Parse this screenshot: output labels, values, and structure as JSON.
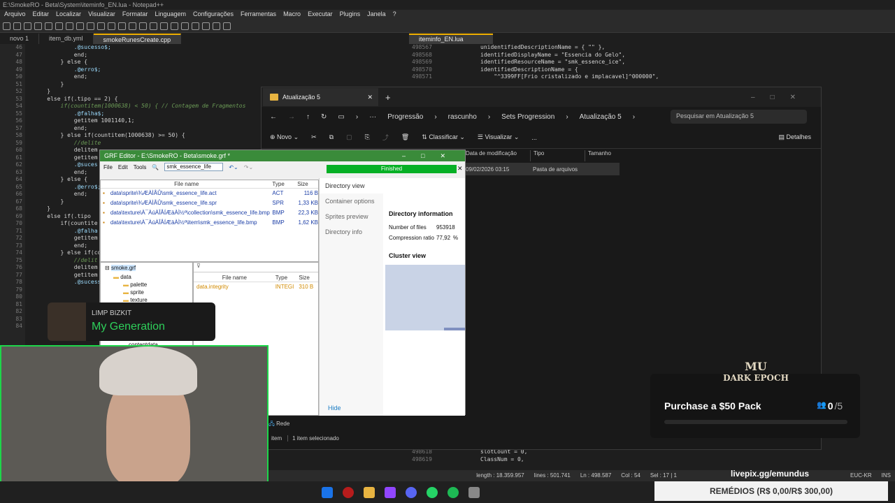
{
  "npp": {
    "title": "E:\\SmokeRO - Beta\\System\\iteminfo_EN.lua - Notepad++",
    "menu": [
      "Arquivo",
      "Editar",
      "Localizar",
      "Visualizar",
      "Formatar",
      "Linguagem",
      "Configurações",
      "Ferramentas",
      "Macro",
      "Executar",
      "Plugins",
      "Janela",
      "?"
    ],
    "tabs_left": [
      "novo 1",
      "item_db.yml",
      "smokeRunesCreate.cpp"
    ],
    "tab_right": "iteminfo_EN.lua",
    "left_lines": [
      "46",
      "47",
      "48",
      "49",
      "50",
      "51",
      "52",
      "53",
      "54",
      "55",
      "56",
      "57",
      "58",
      "59",
      "60",
      "61",
      "62",
      "63",
      "64",
      "65",
      "66",
      "67",
      "68",
      "69",
      "70",
      "71",
      "72",
      "73",
      "74",
      "75",
      "76",
      "77",
      "78",
      "79",
      "80",
      "81",
      "82",
      "83",
      "84"
    ],
    "left_code": [
      "            .@sucesso$;",
      "            end;",
      "        } else {",
      "            .@erro$;",
      "            end;",
      "        }",
      "    }",
      "    else if(.tipo == 2) {",
      "        if(countitem(1000638) < 50) { // Contagem de Fragmentos",
      "            .@falha$;",
      "            getitem 1001140,1;",
      "            end;",
      "        } else if(countitem(1000638) >= 50) {",
      "            //delite",
      "            delitem",
      "            getitem",
      "            .@suces",
      "            end;",
      "        } else {",
      "            .@erro$;",
      "            end;",
      "        }",
      "    }",
      "    else if(.tipo",
      "        if(countite",
      "            .@falha",
      "            getitem",
      "            end;",
      "        } else if(co",
      "            //delit",
      "            delitem",
      "            getitem",
      "            .@sucess",
      "",
      "",
      "",
      "",
      "",
      ""
    ],
    "right_lines": [
      "498567",
      "498568",
      "498569",
      "498570",
      "498571"
    ],
    "right_code": [
      "unidentifiedDescriptionName = { \"\" },",
      "identifiedDisplayName = \"Essencia do Gelo\",",
      "identifiedResourceName = \"smk_essence_ice\",",
      "identifiedDescriptionName = {",
      "    \"^3399FF[Frio cristalizado e implacavel]^000000\","
    ],
    "right_bottom_lines": [
      "498618",
      "498619"
    ],
    "right_bottom_code": [
      "slotCount = 0,",
      "ClassNum = 0,"
    ],
    "status": {
      "length": "length : 18.359.957",
      "lines": "lines : 501.741",
      "pos": "Ln : 498.587",
      "col": "Col : 54",
      "sel": "Sel : 17 | 1",
      "enc": "EUC-KR",
      "ins": "INS"
    }
  },
  "explorer": {
    "tab_title": "Atualização 5",
    "breadcrumb": [
      "Progressão",
      "rascunho",
      "Sets Progression",
      "Atualização 5"
    ],
    "search_placeholder": "Pesquisar em Atualização 5",
    "cmd": {
      "new": "Novo",
      "sort": "Classificar",
      "view": "Visualizar",
      "more": "...",
      "details": "Detalhes"
    },
    "columns": [
      "Data de modificação",
      "Tipo",
      "Tamanho"
    ],
    "row": {
      "date": "09/02/2026 03:15",
      "type": "Pasta de arquivos"
    },
    "sidebar_item": "Rede",
    "status_count": "item",
    "status_selected": "1 item selecionado"
  },
  "grf": {
    "title": "GRF Editor - E:\\SmokeRO - Beta\\smoke.grf *",
    "menu": [
      "File",
      "Edit",
      "Tools"
    ],
    "search_value": "smk_essence_life",
    "progress_label": "Finished",
    "cols": [
      "File name",
      "Type",
      "Size"
    ],
    "files": [
      {
        "name": "data\\sprite\\¾ÆÀÌÅÛ\\smk_essence_life.act",
        "type": "ACT",
        "size": "116 B"
      },
      {
        "name": "data\\sprite\\¾ÆÀÌÅÛ\\smk_essence_life.spr",
        "type": "SPR",
        "size": "1,33 KB"
      },
      {
        "name": "data\\texture\\À¯ÀúÀÎÅÍÆäÀÌ½º\\collection\\smk_essence_life.bmp",
        "type": "BMP",
        "size": "22,3 KB"
      },
      {
        "name": "data\\texture\\À¯ÀúÀÎÅÍÆäÀÌ½º\\item\\smk_essence_life.bmp",
        "type": "BMP",
        "size": "1,62 KB"
      }
    ],
    "tree": [
      "smoke.grf",
      "data",
      "palette",
      "sprite",
      "texture",
      "contentdata"
    ],
    "sub_cols": [
      "File name",
      "Type",
      "Size"
    ],
    "sub_file": {
      "name": "data.integrity",
      "type": "INTEGI",
      "size": "310 B"
    },
    "side": [
      "Directory view",
      "Container options",
      "Sprites preview",
      "Directory info"
    ],
    "hide": "Hide",
    "info": {
      "heading": "Directory information",
      "files_label": "Number of files",
      "files_value": "953918",
      "ratio_label": "Compression ratio",
      "ratio_value": "77,92",
      "ratio_unit": "%",
      "cluster": "Cluster view"
    }
  },
  "music": {
    "artist": "LIMP BIZKIT",
    "song": "My Generation"
  },
  "purchase": {
    "brand_top": "MU",
    "brand_bottom": "DARK EPOCH",
    "label": "Purchase a $50 Pack",
    "count": "0",
    "total": "/5"
  },
  "livepix": "livepix.gg/emundus",
  "remedios": "REMÉDIOS (R$ 0,00/R$ 300,00)",
  "colors": {
    "accent_green": "#06b025",
    "npp_bg": "#1e1e1e",
    "webcam_border": "#1dd64a"
  }
}
